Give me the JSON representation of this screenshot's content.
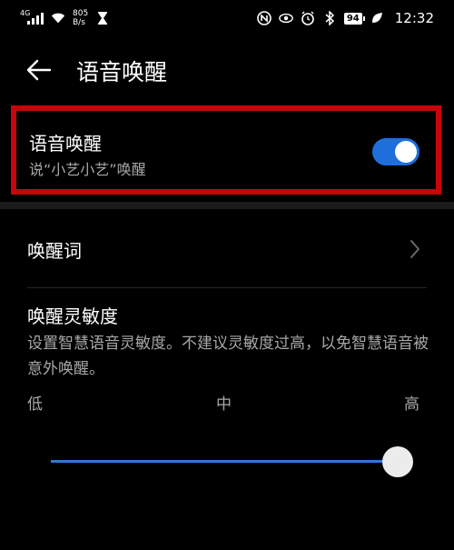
{
  "status_bar": {
    "network_tag": "4G",
    "net_speed_value": "805",
    "net_speed_unit": "B/s",
    "battery": "94",
    "time": "12:32"
  },
  "header": {
    "title": "语音唤醒"
  },
  "voice_wake": {
    "title": "语音唤醒",
    "subtitle": "说“小艺小艺”唤醒",
    "enabled": true
  },
  "wake_word": {
    "label": "唤醒词"
  },
  "sensitivity": {
    "title": "唤醒灵敏度",
    "description": "设置智慧语音灵敏度。不建议灵敏度过高，以免智慧语音被意外唤醒。",
    "low_label": "低",
    "mid_label": "中",
    "high_label": "高",
    "value": 1.0
  },
  "colors": {
    "accent": "#1e6fdc",
    "highlight_border": "#c8050b",
    "background": "#000000"
  },
  "icons": {
    "back": "arrow-left-icon",
    "chevron": "chevron-right-icon"
  }
}
